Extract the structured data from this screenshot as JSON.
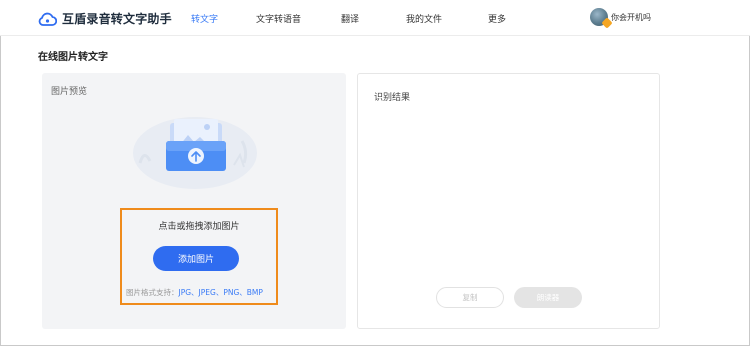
{
  "app": {
    "title": "互盾录音转文字助手"
  },
  "nav": {
    "items": [
      {
        "label": "转文字",
        "active": true
      },
      {
        "label": "文字转语音",
        "active": false
      },
      {
        "label": "翻译",
        "active": false
      },
      {
        "label": "我的文件",
        "active": false
      },
      {
        "label": "更多",
        "active": false
      }
    ]
  },
  "user": {
    "name": "你会开机吗"
  },
  "page": {
    "title": "在线图片转文字"
  },
  "preview": {
    "label": "图片预览",
    "hint": "点击或拖拽添加图片",
    "add_button": "添加图片",
    "formats_prefix": "图片格式支持：",
    "formats": "JPG、JPEG、PNG、BMP"
  },
  "result": {
    "label": "识别结果",
    "copy_button": "复制",
    "read_button": "朗读器"
  },
  "colors": {
    "accent": "#2f6cf0",
    "highlight_border": "#ef8b1c"
  }
}
